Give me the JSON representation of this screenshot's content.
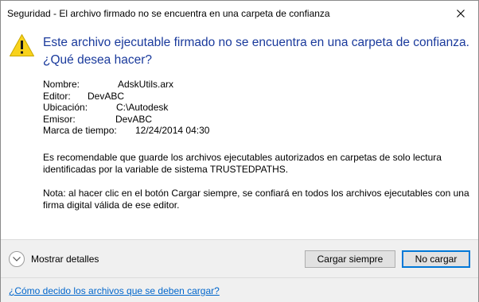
{
  "window": {
    "title": "Seguridad - El archivo firmado no se encuentra en una carpeta de confianza"
  },
  "message": {
    "line1": "Este archivo ejecutable firmado no se encuentra en una carpeta de confianza.",
    "line2": "¿Qué desea hacer?"
  },
  "details": {
    "name_label": "Nombre:",
    "name_value": "AdskUtils.arx",
    "editor_label": "Editor:",
    "editor_value": "DevABC",
    "location_label": "Ubicación:",
    "location_value": "C:\\Autodesk",
    "issuer_label": "Emisor:",
    "issuer_value": "DevABC",
    "timestamp_label": "Marca de tiempo:",
    "timestamp_value": "12/24/2014 04:30"
  },
  "paragraphs": {
    "recommendation": "Es recomendable que guarde los archivos ejecutables autorizados en carpetas de solo lectura identificadas por la variable de sistema TRUSTEDPATHS.",
    "note": "Nota: al hacer clic en el botón Cargar siempre, se confiará en todos los archivos ejecutables con una firma digital válida de ese editor."
  },
  "footer": {
    "show_details": "Mostrar detalles",
    "load_always": "Cargar siempre",
    "do_not_load": "No cargar"
  },
  "help": {
    "link_text": "¿Cómo decido los archivos que se deben cargar?"
  },
  "colors": {
    "heading": "#1a3a9c",
    "warning_yellow": "#f8d21c",
    "link": "#0066cc",
    "default_button_border": "#0078d7"
  },
  "icons": {
    "warning": "warning-triangle-icon",
    "close": "close-icon",
    "expand": "chevron-down-icon"
  }
}
